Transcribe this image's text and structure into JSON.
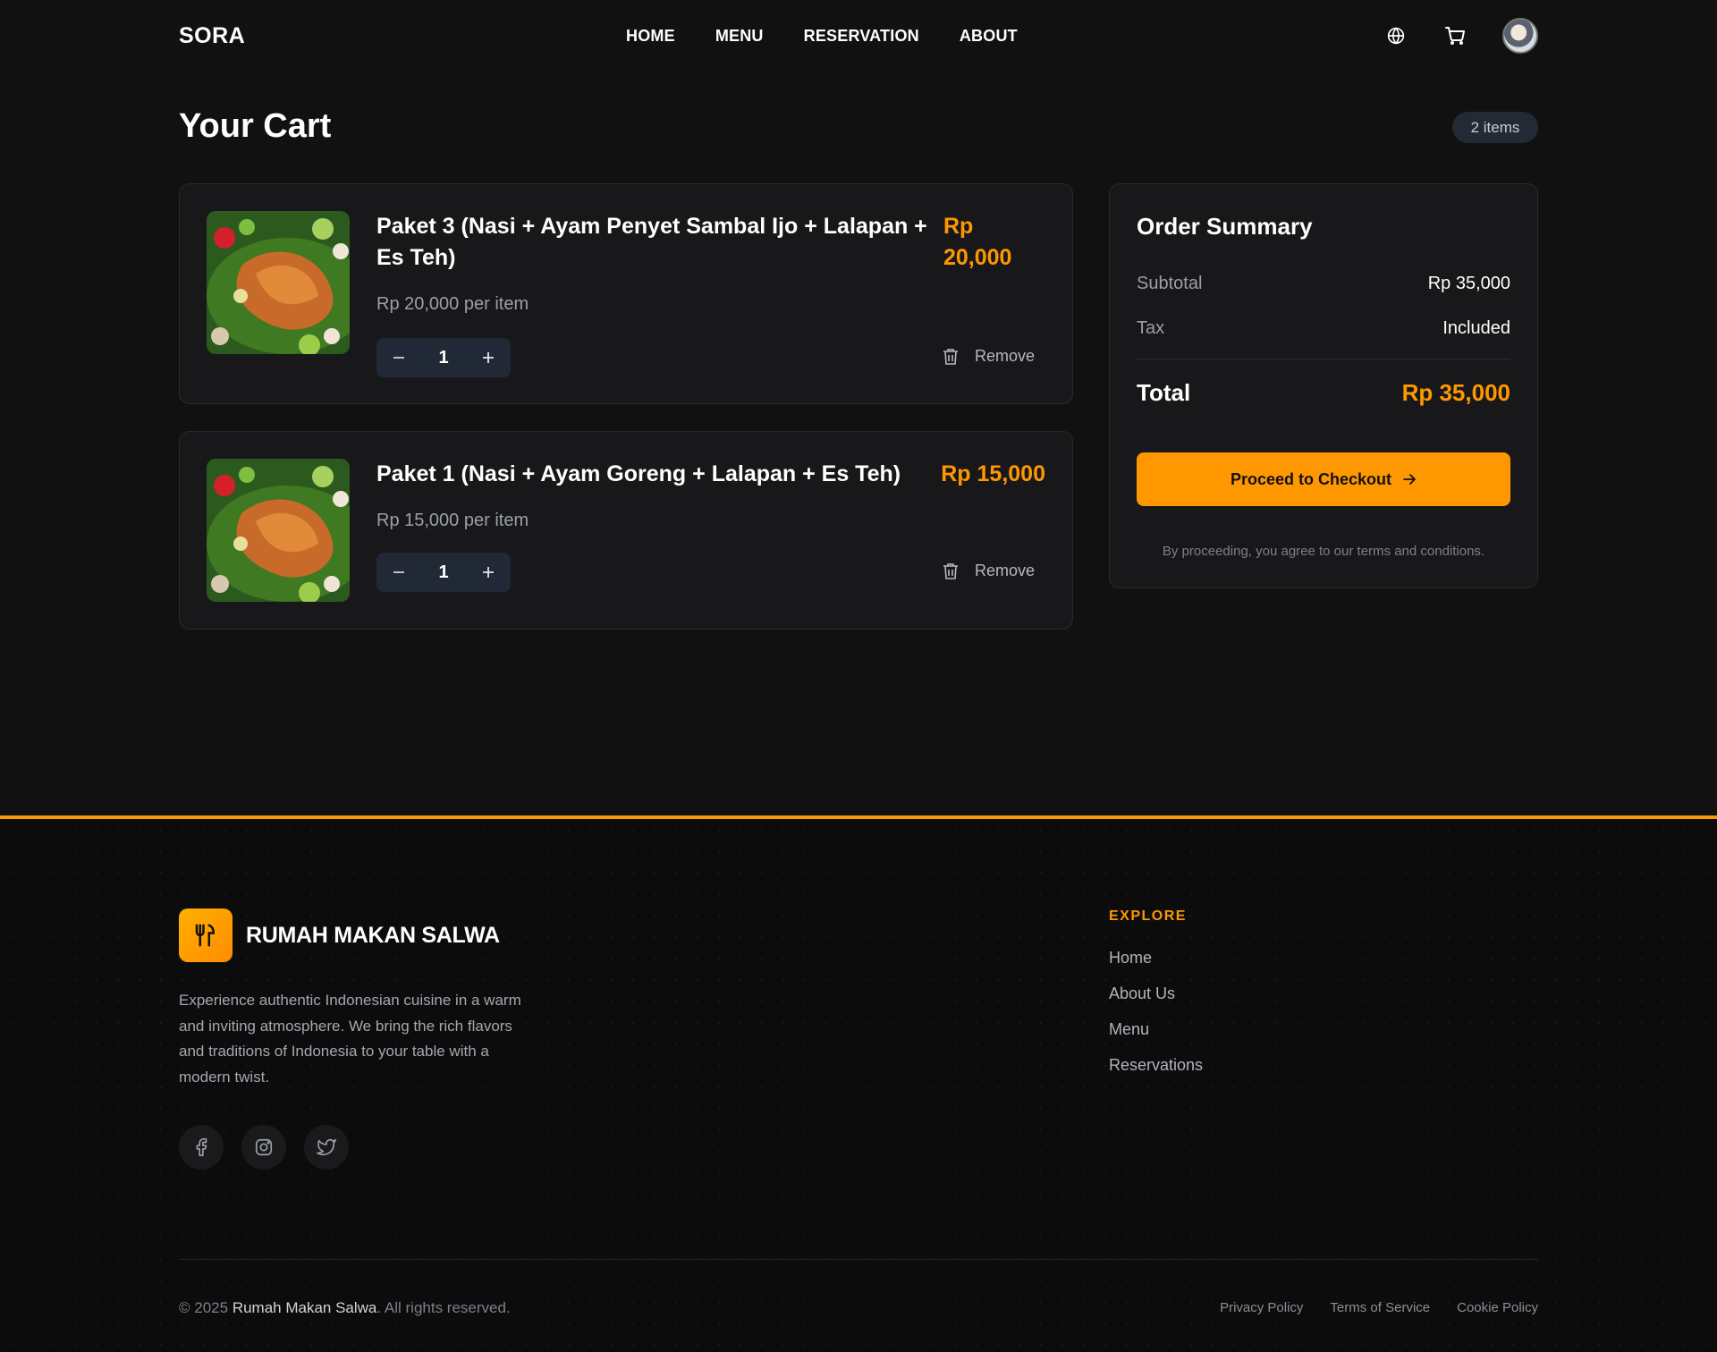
{
  "header": {
    "brand": "SORA",
    "nav": [
      "HOME",
      "MENU",
      "RESERVATION",
      "ABOUT"
    ],
    "icons": [
      "globe-icon",
      "cart-icon"
    ]
  },
  "cart": {
    "title": "Your Cart",
    "count_label": "2 items",
    "items": [
      {
        "name": "Paket 3 (Nasi + Ayam Penyet Sambal Ijo + Lalapan + Es Teh)",
        "price": "Rp 20,000",
        "unit_price": "Rp 20,000 per item",
        "quantity": "1",
        "remove_label": "Remove"
      },
      {
        "name": "Paket 1 (Nasi + Ayam Goreng + Lalapan + Es Teh)",
        "price": "Rp 15,000",
        "unit_price": "Rp 15,000 per item",
        "quantity": "1",
        "remove_label": "Remove"
      }
    ]
  },
  "summary": {
    "title": "Order Summary",
    "subtotal_label": "Subtotal",
    "subtotal_value": "Rp 35,000",
    "tax_label": "Tax",
    "tax_value": "Included",
    "total_label": "Total",
    "total_value": "Rp 35,000",
    "checkout_label": "Proceed to Checkout",
    "terms": "By proceeding, you agree to our terms and conditions."
  },
  "footer": {
    "brand": "RUMAH MAKAN SALWA",
    "description": "Experience authentic Indonesian cuisine in a warm and inviting atmosphere. We bring the rich flavors and traditions of Indonesia to your table with a modern twist.",
    "socials": [
      "facebook-icon",
      "instagram-icon",
      "twitter-icon"
    ],
    "explore_heading": "EXPLORE",
    "explore_links": [
      "Home",
      "About Us",
      "Menu",
      "Reservations"
    ],
    "copyright_prefix": "© 2025",
    "copyright_name": "Rumah Makan Salwa",
    "copyright_suffix": ". All rights reserved.",
    "legal_links": [
      "Privacy Policy",
      "Terms of Service",
      "Cookie Policy"
    ]
  },
  "colors": {
    "accent": "#ff9800",
    "background": "#111112",
    "card": "#18181a"
  }
}
